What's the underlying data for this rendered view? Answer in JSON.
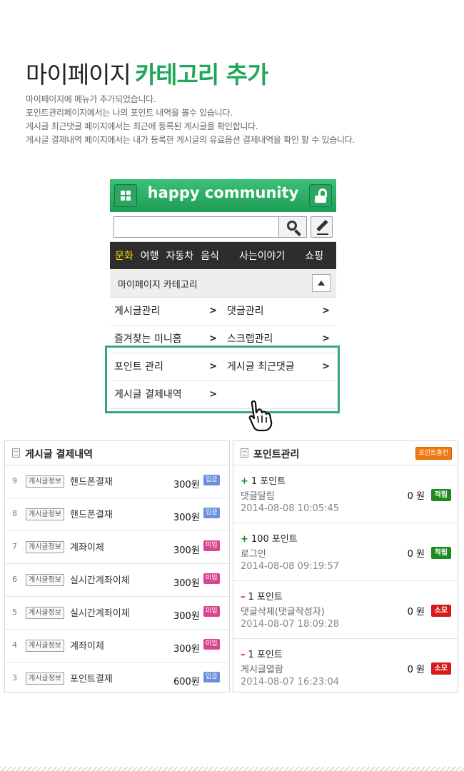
{
  "title": {
    "main": "마이페이지",
    "accent": "카테고리 추가"
  },
  "description": [
    "마이페이지에 메뉴가 추가되었습니다.",
    "포인트관리페이지에서는 나의 포인트 내역을 볼수 있습니다.",
    "게시글 최근댓글 페이지에서는 최근에 등록된 게시글을 확인합니다.",
    "게시글 결제내역 페이지에서는 내가 등록한 게시글의 유료옵션 결제내역을 확인 할 수 있습니다."
  ],
  "phone": {
    "logo": "happy community",
    "search": {
      "value": "",
      "placeholder": ""
    },
    "nav": [
      "문화",
      "여행",
      "자동차",
      "음식",
      "사는이야기",
      "쇼핑"
    ],
    "category_title": "마이페이지 카테고리",
    "menu": [
      [
        "게시글관리",
        "댓글관리"
      ],
      [
        "즐겨찾는 미니홈",
        "스크랩관리"
      ],
      [
        "포인트 관리",
        "게시글 최근댓글"
      ],
      [
        "게시글 결제내역",
        ""
      ]
    ],
    "arrow": ">"
  },
  "payments": {
    "title": "게시글 결제내역",
    "tag_label": "게시글정보",
    "rows": [
      {
        "num": "9",
        "name": "핸드폰결재",
        "amount": "300원",
        "status": "입금",
        "kind": "in"
      },
      {
        "num": "8",
        "name": "핸드폰결재",
        "amount": "300원",
        "status": "입금",
        "kind": "in"
      },
      {
        "num": "7",
        "name": "계좌이체",
        "amount": "300원",
        "status": "미입",
        "kind": "un"
      },
      {
        "num": "6",
        "name": "실시간계좌이체",
        "amount": "300원",
        "status": "미입",
        "kind": "un"
      },
      {
        "num": "5",
        "name": "실시간계좌이체",
        "amount": "300원",
        "status": "미입",
        "kind": "un"
      },
      {
        "num": "4",
        "name": "계좌이체",
        "amount": "300원",
        "status": "미입",
        "kind": "un"
      },
      {
        "num": "3",
        "name": "포인트결제",
        "amount": "600원",
        "status": "입금",
        "kind": "in"
      }
    ]
  },
  "points": {
    "title": "포인트관리",
    "charge_label": "포인트충전",
    "rows": [
      {
        "sign": "+",
        "points": "1 포인트",
        "reason": "댓글달림",
        "date": "2014-08-08 10:05:45",
        "amount": "0 원",
        "badge": "적립",
        "kind": "earn"
      },
      {
        "sign": "+",
        "points": "100 포인트",
        "reason": "로그인",
        "date": "2014-08-08 09:19:57",
        "amount": "0 원",
        "badge": "적립",
        "kind": "earn"
      },
      {
        "sign": "–",
        "points": "1 포인트",
        "reason": "댓글삭제(댓글작성자)",
        "date": "2014-08-07 18:09:28",
        "amount": "0 원",
        "badge": "소모",
        "kind": "use"
      },
      {
        "sign": "–",
        "points": "1 포인트",
        "reason": "게시글열람",
        "date": "2014-08-07 16:23:04",
        "amount": "0 원",
        "badge": "소모",
        "kind": "use"
      }
    ]
  },
  "colors": {
    "accent": "#1fa75a",
    "header_top": "#3cc077",
    "nav_bg": "#2d2d2d",
    "nav_active": "#ffd700",
    "highlight": "#35a974"
  }
}
